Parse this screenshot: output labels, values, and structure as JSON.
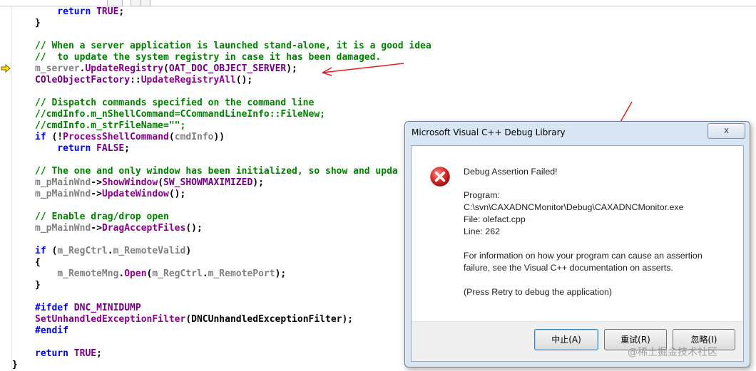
{
  "editor": {
    "lines": [
      {
        "id": "l1",
        "parts": [
          {
            "t": "    return ",
            "c": "kw"
          },
          {
            "t": "TRUE",
            "c": "mc"
          },
          {
            "t": ";",
            "c": ""
          }
        ]
      },
      {
        "id": "l2",
        "parts": [
          {
            "t": "}",
            "c": ""
          }
        ]
      },
      {
        "id": "l3",
        "parts": []
      },
      {
        "id": "l4",
        "parts": [
          {
            "t": "// When a server application is launched stand-alone, it is a good idea",
            "c": "cm"
          }
        ]
      },
      {
        "id": "l5",
        "parts": [
          {
            "t": "//  to update the system registry in case it has been damaged.",
            "c": "cm"
          }
        ]
      },
      {
        "id": "l6",
        "parts": [
          {
            "t": "m_server",
            "c": "vr"
          },
          {
            "t": ".",
            "c": ""
          },
          {
            "t": "UpdateRegistry",
            "c": "fn"
          },
          {
            "t": "(",
            "c": ""
          },
          {
            "t": "OAT_DOC_OBJECT_SERVER",
            "c": "mc"
          },
          {
            "t": ");",
            "c": ""
          }
        ]
      },
      {
        "id": "l7",
        "parts": [
          {
            "t": "COleObjectFactory",
            "c": "mc"
          },
          {
            "t": "::",
            "c": ""
          },
          {
            "t": "UpdateRegistryAll",
            "c": "fn"
          },
          {
            "t": "();",
            "c": ""
          }
        ]
      },
      {
        "id": "l8",
        "parts": []
      },
      {
        "id": "l9",
        "parts": [
          {
            "t": "// Dispatch commands specified on the command line",
            "c": "cm"
          }
        ]
      },
      {
        "id": "l10",
        "parts": [
          {
            "t": "//cmdInfo.m_nShellCommand=CCommandLineInfo::FileNew;",
            "c": "cm"
          }
        ]
      },
      {
        "id": "l11",
        "parts": [
          {
            "t": "//cmdInfo.m_strFileName=\"\";",
            "c": "cm"
          }
        ]
      },
      {
        "id": "l12",
        "parts": [
          {
            "t": "if",
            "c": "kw"
          },
          {
            "t": " (!",
            "c": ""
          },
          {
            "t": "ProcessShellCommand",
            "c": "fn"
          },
          {
            "t": "(",
            "c": ""
          },
          {
            "t": "cmdInfo",
            "c": "vr"
          },
          {
            "t": "))",
            "c": ""
          }
        ]
      },
      {
        "id": "l13",
        "parts": [
          {
            "t": "    return ",
            "c": "kw"
          },
          {
            "t": "FALSE",
            "c": "mc"
          },
          {
            "t": ";",
            "c": ""
          }
        ]
      },
      {
        "id": "l14",
        "parts": []
      },
      {
        "id": "l15",
        "parts": [
          {
            "t": "// The one and only window has been initialized, so show and upda",
            "c": "cm"
          }
        ]
      },
      {
        "id": "l16",
        "parts": [
          {
            "t": "m_pMainWnd",
            "c": "vr"
          },
          {
            "t": "->",
            "c": ""
          },
          {
            "t": "ShowWindow",
            "c": "fn"
          },
          {
            "t": "(",
            "c": ""
          },
          {
            "t": "SW_SHOWMAXIMIZED",
            "c": "mc"
          },
          {
            "t": ");",
            "c": ""
          }
        ]
      },
      {
        "id": "l17",
        "parts": [
          {
            "t": "m_pMainWnd",
            "c": "vr"
          },
          {
            "t": "->",
            "c": ""
          },
          {
            "t": "UpdateWindow",
            "c": "fn"
          },
          {
            "t": "();",
            "c": ""
          }
        ]
      },
      {
        "id": "l18",
        "parts": []
      },
      {
        "id": "l19",
        "parts": [
          {
            "t": "// Enable drag/drop open",
            "c": "cm"
          }
        ]
      },
      {
        "id": "l20",
        "parts": [
          {
            "t": "m_pMainWnd",
            "c": "vr"
          },
          {
            "t": "->",
            "c": ""
          },
          {
            "t": "DragAcceptFiles",
            "c": "fn"
          },
          {
            "t": "();",
            "c": ""
          }
        ]
      },
      {
        "id": "l21",
        "parts": []
      },
      {
        "id": "l22",
        "parts": [
          {
            "t": "if",
            "c": "kw"
          },
          {
            "t": " (",
            "c": ""
          },
          {
            "t": "m_RegCtrl",
            "c": "vr"
          },
          {
            "t": ".",
            "c": ""
          },
          {
            "t": "m_RemoteValid",
            "c": "vr"
          },
          {
            "t": ")",
            "c": ""
          }
        ]
      },
      {
        "id": "l23",
        "parts": [
          {
            "t": "{",
            "c": ""
          }
        ]
      },
      {
        "id": "l24",
        "parts": [
          {
            "t": "    ",
            "c": ""
          },
          {
            "t": "m_RemoteMng",
            "c": "vr"
          },
          {
            "t": ".",
            "c": ""
          },
          {
            "t": "Open",
            "c": "fn"
          },
          {
            "t": "(",
            "c": ""
          },
          {
            "t": "m_RegCtrl",
            "c": "vr"
          },
          {
            "t": ".",
            "c": ""
          },
          {
            "t": "m_RemotePort",
            "c": "vr"
          },
          {
            "t": ");",
            "c": ""
          }
        ]
      },
      {
        "id": "l25",
        "parts": [
          {
            "t": "}",
            "c": ""
          }
        ]
      },
      {
        "id": "l26",
        "parts": []
      },
      {
        "id": "l27",
        "parts": [
          {
            "t": "#ifdef",
            "c": "kw"
          },
          {
            "t": " DNC_MINIDUMP",
            "c": "mc"
          }
        ]
      },
      {
        "id": "l28",
        "parts": [
          {
            "t": "SetUnhandledExceptionFilter",
            "c": "fn"
          },
          {
            "t": "(DNCUnhandledExceptionFilter);",
            "c": ""
          }
        ]
      },
      {
        "id": "l29",
        "parts": [
          {
            "t": "#endif",
            "c": "kw"
          }
        ]
      },
      {
        "id": "l30",
        "parts": []
      },
      {
        "id": "l31",
        "parts": [
          {
            "t": "return ",
            "c": "kw"
          },
          {
            "t": "TRUE",
            "c": "mc"
          },
          {
            "t": ";",
            "c": ""
          }
        ]
      }
    ],
    "last_brace": "}"
  },
  "dialog": {
    "title": "Microsoft Visual C++ Debug Library",
    "close_label": "x",
    "heading": "Debug Assertion Failed!",
    "program_label": "Program:",
    "program_path": "C:\\svn\\CAXADNCMonitor\\Debug\\CAXADNCMonitor.exe",
    "file_line": "File: olefact.cpp",
    "line_line": "Line: 262",
    "info_1": "For information on how your program can cause an assertion",
    "info_2": "failure, see the Visual C++ documentation on asserts.",
    "retry_hint": "(Press Retry to debug the application)",
    "buttons": {
      "abort": "中止(A)",
      "retry": "重试(R)",
      "ignore": "忽略(I)"
    }
  },
  "watermark": "@稀土掘金技术社区",
  "colors": {
    "keyword": "#0000ff",
    "comment": "#008000",
    "function": "#880088",
    "variable": "#808080",
    "macro": "#6f0080",
    "error_red": "#d42a2a",
    "annotation_arrow": "#e02020"
  }
}
